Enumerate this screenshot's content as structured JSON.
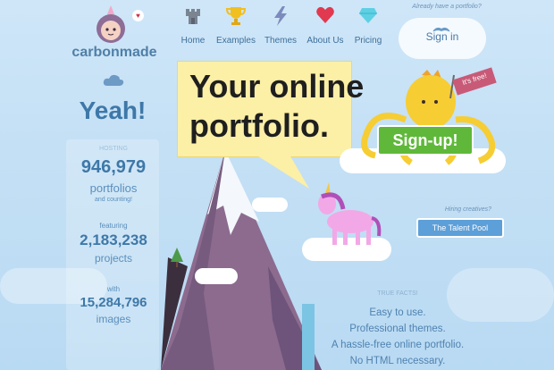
{
  "brand": {
    "name": "carbonmade"
  },
  "nav": [
    {
      "label": "Home",
      "icon": "castle-icon"
    },
    {
      "label": "Examples",
      "icon": "trophy-icon"
    },
    {
      "label": "Themes",
      "icon": "lightning-icon"
    },
    {
      "label": "About Us",
      "icon": "heart-icon"
    },
    {
      "label": "Pricing",
      "icon": "diamond-icon"
    }
  ],
  "signin": {
    "prompt": "Already have a portfolio?",
    "label": "Sign in"
  },
  "headline": {
    "line1": "Your online",
    "line2": "portfolio."
  },
  "signup": {
    "label": "Sign-up!",
    "flag": "It's free!"
  },
  "sidebar": {
    "greeting": "Yeah!",
    "hosting": "HOSTING",
    "portfolios_num": "946,979",
    "portfolios_label": "portfolios",
    "portfolios_note": "and counting!",
    "featuring": "featuring",
    "projects_num": "2,183,238",
    "projects_label": "projects",
    "with": "with",
    "images_num": "15,284,796",
    "images_label": "images"
  },
  "talent": {
    "prompt": "Hiring creatives?",
    "label": "The Talent Pool"
  },
  "facts": {
    "title": "TRUE FACTS!",
    "items": [
      "Easy to use.",
      "Professional themes.",
      "A hassle-free online portfolio.",
      "No HTML necessary."
    ]
  },
  "colors": {
    "accent": "#3e78a8",
    "signup": "#5fb83a",
    "sky": "#c4e0f5",
    "mountain": "#8a6a8e",
    "bubble": "#fcefa6"
  }
}
